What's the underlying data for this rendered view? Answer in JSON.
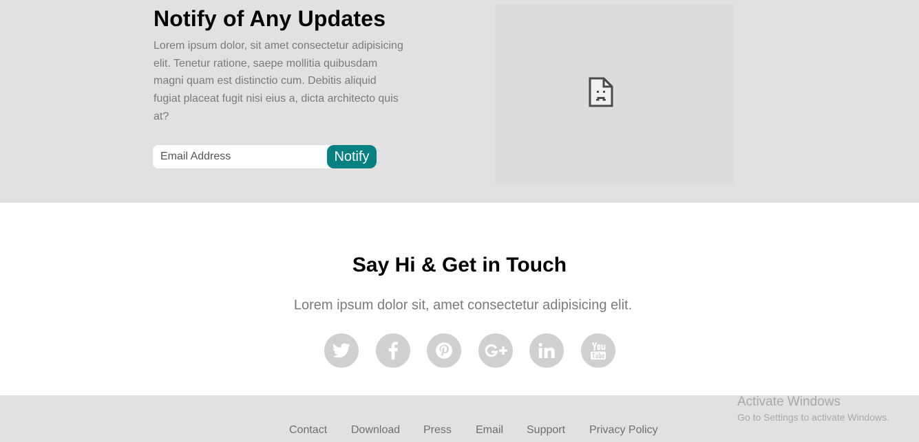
{
  "notify": {
    "title": "Notify of Any Updates",
    "text": "Lorem ipsum dolor, sit amet consectetur adipisicing elit. Tenetur ratione, saepe mollitia quibusdam magni quam est distinctio cum. Debitis aliquid fugiat placeat fugit nisi eius a, dicta architecto quis at?",
    "email_placeholder": "Email Address",
    "button_label": "Notify",
    "accent_color": "#068080",
    "image_icon": "broken-image-icon"
  },
  "contact": {
    "title": "Say Hi & Get in Touch",
    "subtitle": "Lorem ipsum dolor sit, amet consectetur adipisicing elit.",
    "social": [
      "twitter-icon",
      "facebook-icon",
      "pinterest-icon",
      "google-plus-icon",
      "linkedin-icon",
      "youtube-icon"
    ]
  },
  "footer": {
    "links": [
      "Contact",
      "Download",
      "Press",
      "Email",
      "Support",
      "Privacy Policy"
    ]
  },
  "watermark": {
    "title": "Activate Windows",
    "subtitle": "Go to Settings to activate Windows."
  }
}
